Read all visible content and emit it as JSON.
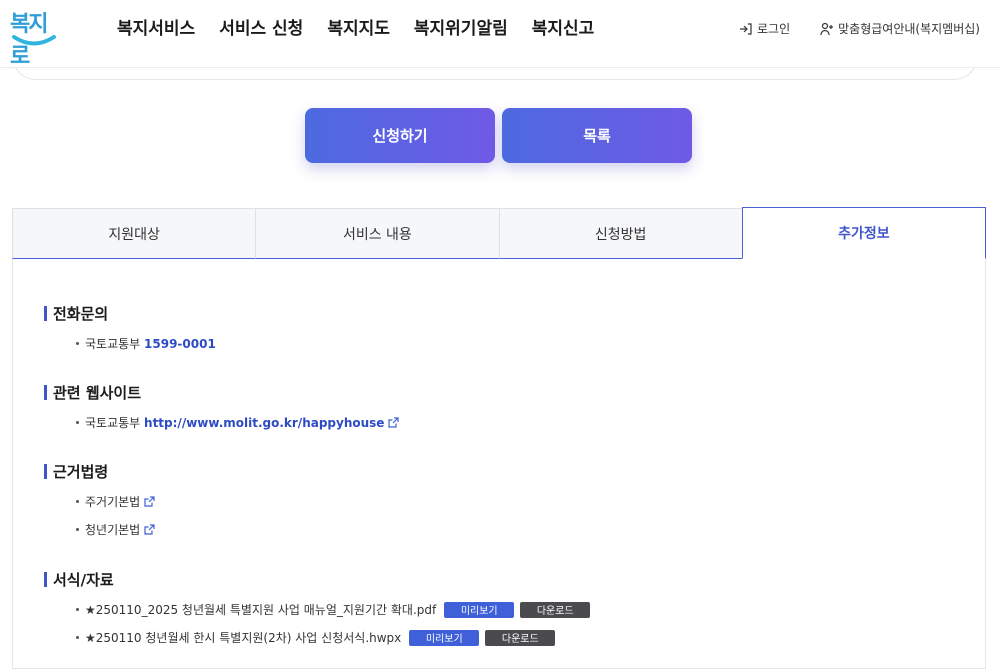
{
  "header": {
    "logo": "복지로",
    "nav": [
      "복지서비스",
      "서비스 신청",
      "복지지도",
      "복지위기알림",
      "복지신고"
    ],
    "login": "로그인",
    "member": "맞춤형급여안내(복지멤버십)"
  },
  "actions": {
    "apply": "신청하기",
    "list": "목록"
  },
  "tabs": [
    {
      "label": "지원대상"
    },
    {
      "label": "서비스 내용"
    },
    {
      "label": "신청방법"
    },
    {
      "label": "추가정보"
    }
  ],
  "content": {
    "phone": {
      "title": "전화문의",
      "org": "국토교통부",
      "number": "1599-0001"
    },
    "website": {
      "title": "관련 웹사이트",
      "org": "국토교통부",
      "url": "http://www.molit.go.kr/happyhouse"
    },
    "laws": {
      "title": "근거법령",
      "items": [
        "주거기본법",
        "청년기본법"
      ]
    },
    "forms": {
      "title": "서식/자료",
      "items": [
        {
          "name": "★250110_2025 청년월세 특별지원 사업 매뉴얼_지원기간 확대.pdf"
        },
        {
          "name": "★250110 청년월세 한시 특별지원(2차) 사업 신청서식.hwpx"
        }
      ],
      "preview_label": "미리보기",
      "download_label": "다운로드"
    }
  }
}
